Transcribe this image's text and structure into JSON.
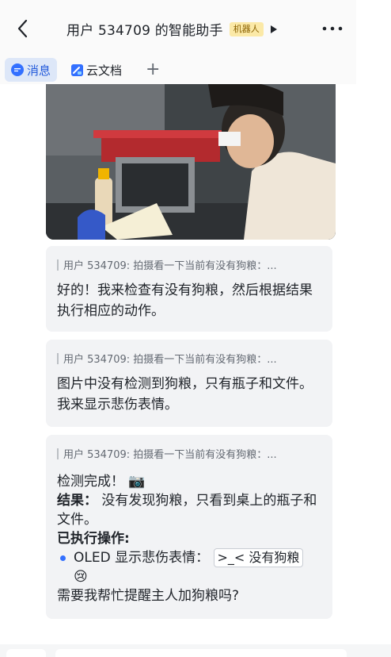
{
  "header": {
    "title": "用户 534709 的智能助手",
    "badge": "机器人",
    "back_icon": "chevron-left-icon",
    "more_icon": "more-horizontal-icon",
    "play_icon": "play-triangle-icon"
  },
  "tabs": [
    {
      "label": "消息",
      "icon": "message-bubble-icon",
      "active": true
    },
    {
      "label": "云文档",
      "icon": "cloud-doc-icon",
      "active": false
    }
  ],
  "tab_add_label": "+",
  "photo": {
    "icon": "camera-photo-icon"
  },
  "messages": [
    {
      "quote": "用户 534709: 拍摄看一下当前有没有狗粮：...",
      "reply": "好的！我来检查有没有狗粮，然后根据结果执行相应的动作。"
    },
    {
      "quote": "用户 534709: 拍摄看一下当前有没有狗粮：...",
      "reply": "图片中没有检测到狗粮，只有瓶子和文件。我来显示悲伤表情。"
    },
    {
      "quote": "用户 534709: 拍摄看一下当前有没有狗粮：...",
      "done": "检测完成！",
      "done_emoji": "📷",
      "result_label": "结果：",
      "result_text": "没有发现狗粮，只看到桌上的瓶子和文件。",
      "action_label": "已执行操作:",
      "bullet_text": "OLED 显示悲伤表情：",
      "code_text": ">_< 没有狗粮",
      "sad_emoji": "😢",
      "question": "需要我帮忙提醒主人加狗粮吗?"
    }
  ],
  "colors": {
    "accent": "#3370ff",
    "badge_bg": "#fbe9a7",
    "card_bg": "#f2f3f5"
  }
}
